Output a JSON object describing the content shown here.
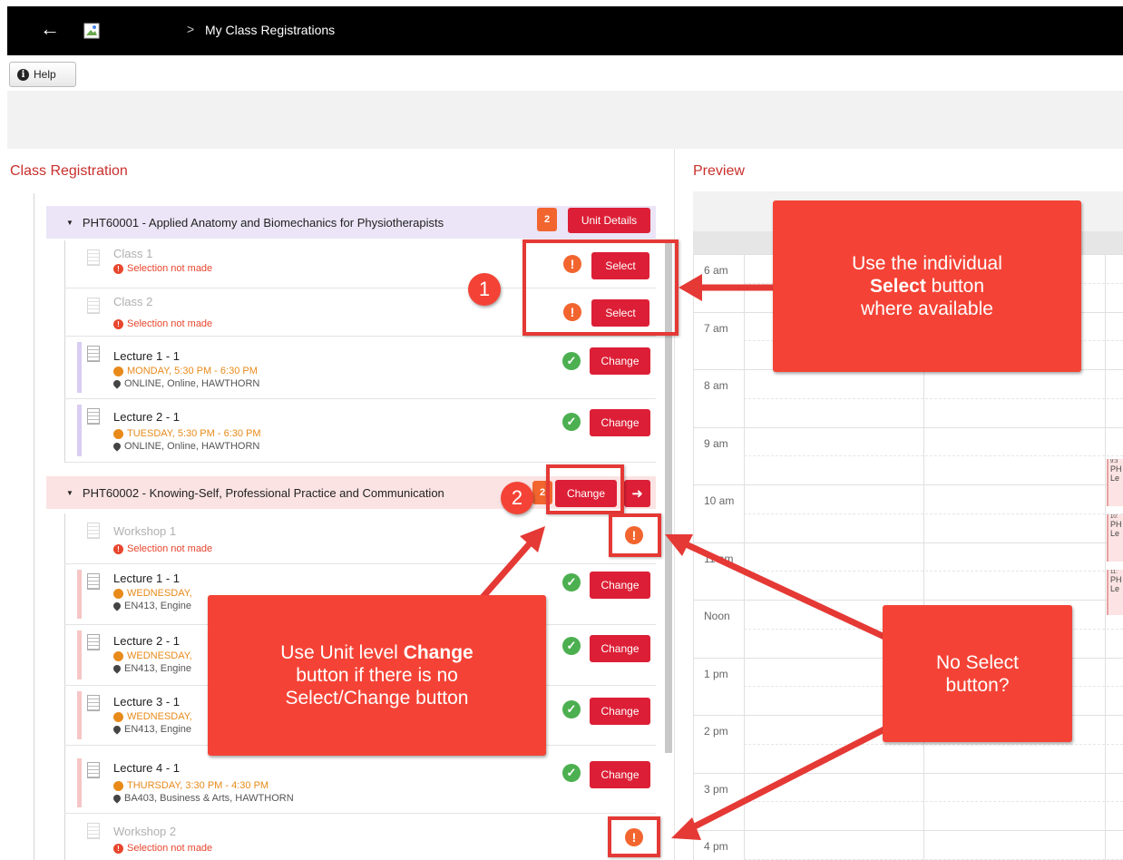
{
  "header": {
    "back_icon": "arrow-left-icon",
    "breadcrumb_sep": ">",
    "breadcrumb": "My Class Registrations"
  },
  "help_label": "Help",
  "left_title": "Class Registration",
  "right_title": "Preview",
  "units": [
    {
      "title": "PHT60001 - Applied Anatomy and Biomechanics for Physiotherapists",
      "count": "2",
      "button": "Unit Details",
      "color": "#ebe5f7"
    },
    {
      "title": "PHT60002 - Knowing-Self, Professional Practice and Communication",
      "count": "2",
      "button": "Change",
      "color": "#fbe3e3"
    }
  ],
  "rows": [
    {
      "title": "Class 1",
      "status": "Selection not made",
      "button": "Select"
    },
    {
      "title": "Class 2",
      "status": "Selection not made",
      "button": "Select"
    },
    {
      "title": "Lecture 1 - 1",
      "time": "MONDAY, 5:30 PM - 6:30 PM",
      "location": "ONLINE, Online, HAWTHORN",
      "button": "Change"
    },
    {
      "title": "Lecture 2 - 1",
      "time": "TUESDAY, 5:30 PM - 6:30 PM",
      "location": "ONLINE, Online, HAWTHORN",
      "button": "Change"
    },
    {
      "title": "Workshop 1",
      "status": "Selection not made"
    },
    {
      "title": "Lecture 1 - 1",
      "time": "WEDNESDAY,",
      "location": "EN413, Engine",
      "button": "Change"
    },
    {
      "title": "Lecture 2 - 1",
      "time": "WEDNESDAY,",
      "location": "EN413, Engine",
      "button": "Change"
    },
    {
      "title": "Lecture 3 - 1",
      "time": "WEDNESDAY,",
      "location": "EN413, Engine",
      "button": "Change"
    },
    {
      "title": "Lecture 4 - 1",
      "time": "THURSDAY, 3:30 PM - 4:30 PM",
      "location": "BA403, Business & Arts, HAWTHORN",
      "button": "Change"
    },
    {
      "title": "Workshop 2",
      "status": "Selection not made"
    }
  ],
  "hours": [
    "6 am",
    "7 am",
    "8 am",
    "9 am",
    "10 am",
    "11 am",
    "Noon",
    "1 pm",
    "2 pm",
    "3 pm",
    "4 pm"
  ],
  "events": [
    {
      "time": "9:3",
      "line1": "PH",
      "line2": "Le"
    },
    {
      "time": "10:",
      "line1": "PH",
      "line2": "Le"
    },
    {
      "time": "11:",
      "line1": "PH",
      "line2": "Le"
    }
  ],
  "callouts": {
    "one": {
      "number": "1",
      "line1": "Use the individual",
      "bold": "Select",
      "line2_rest": " button",
      "line3": "where available"
    },
    "two": {
      "number": "2",
      "line1_pre": "Use Unit level ",
      "bold": "Change",
      "line2": "button if there is no",
      "line3": "Select/Change button"
    },
    "three": {
      "line1": "No Select",
      "line2": "button?"
    }
  },
  "colors": {
    "accent_red": "#dc1f36",
    "callout_red": "#f44336",
    "warning_orange": "#f2652f",
    "success_green": "#4caf50",
    "time_orange": "#e88a1a"
  }
}
